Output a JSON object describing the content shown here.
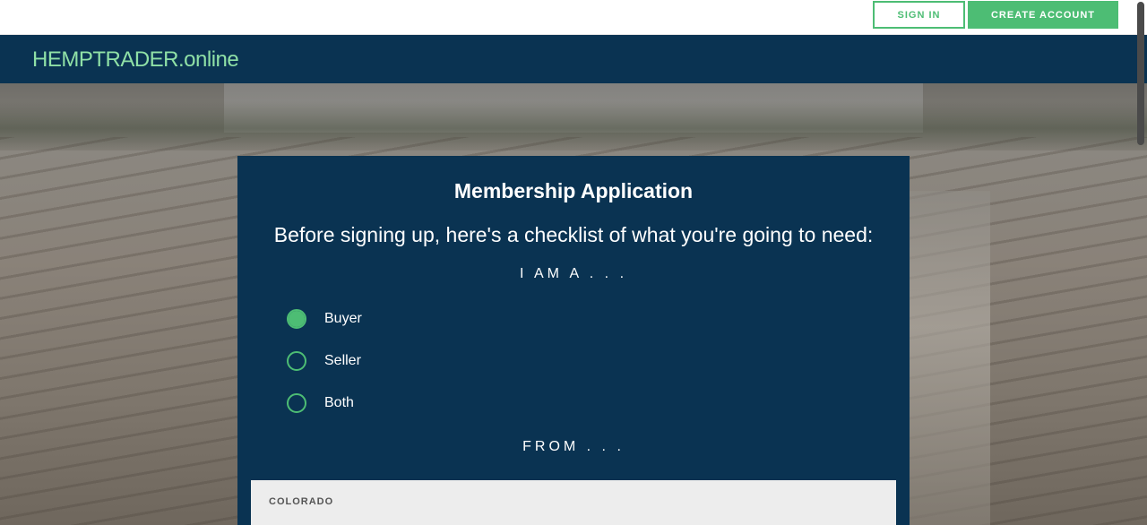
{
  "header": {
    "signin_label": "SIGN IN",
    "create_account_label": "CREATE ACCOUNT"
  },
  "nav": {
    "logo_brand": "HEMPTRADER",
    "logo_tld": ".online"
  },
  "form": {
    "title": "Membership Application",
    "subtitle": "Before signing up, here's a checklist of what you're going to need:",
    "role_label": "I AM A . . .",
    "roles": [
      {
        "label": "Buyer",
        "selected": true
      },
      {
        "label": "Seller",
        "selected": false
      },
      {
        "label": "Both",
        "selected": false
      }
    ],
    "from_label": "FROM . . .",
    "state_value": "COLORADO"
  },
  "colors": {
    "accent": "#4dbd74",
    "navy": "#0a3352",
    "logo": "#8fe0a6"
  }
}
